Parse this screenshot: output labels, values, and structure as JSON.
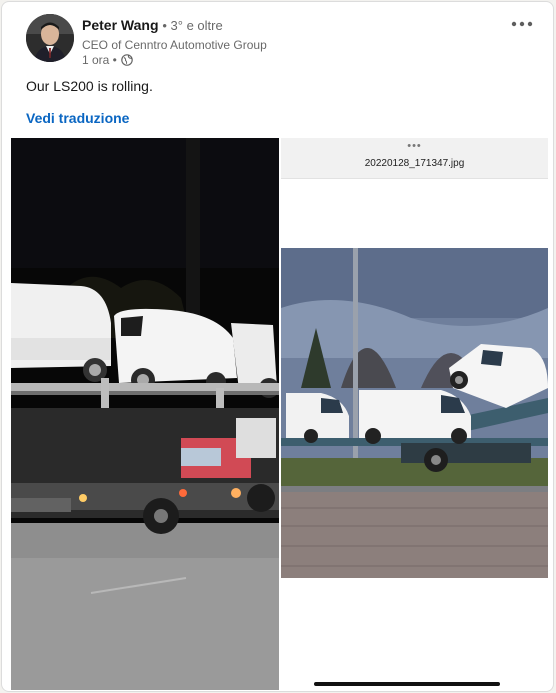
{
  "author": {
    "name": "Peter Wang",
    "degree": "• 3° e oltre",
    "headline": "CEO of Cenntro Automotive Group",
    "time": "1 ora •"
  },
  "post": {
    "text": "Our LS200 is rolling.",
    "translate_label": "Vedi traduzione"
  },
  "media": {
    "right_filename": "20220128_171347.jpg",
    "right_dots": "•••"
  },
  "icons": {
    "more": "more-horizontal-icon",
    "visibility": "globe-icon"
  },
  "colors": {
    "link": "#0a66c2",
    "text_primary": "rgba(0,0,0,0.9)",
    "text_secondary": "rgba(0,0,0,0.6)"
  }
}
